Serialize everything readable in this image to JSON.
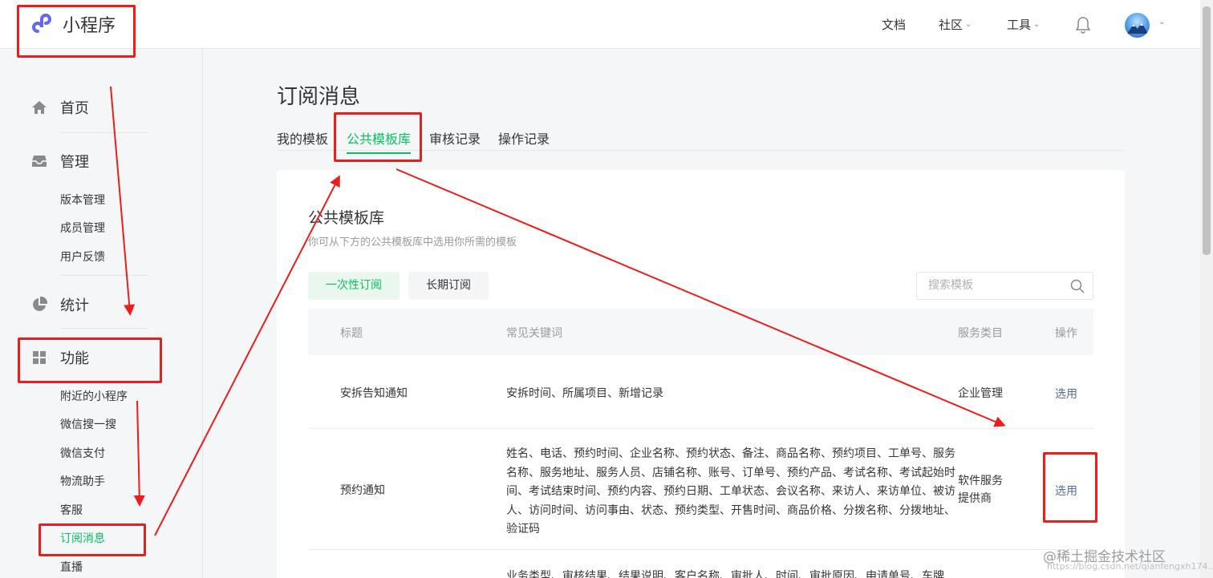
{
  "header": {
    "logo_text": "小程序",
    "nav": {
      "docs": "文档",
      "community": "社区",
      "tools": "工具"
    }
  },
  "sidebar": {
    "home": "首页",
    "manage": "管理",
    "manage_items": [
      "版本管理",
      "成员管理",
      "用户反馈"
    ],
    "stats": "统计",
    "features": "功能",
    "feature_items": [
      "附近的小程序",
      "微信搜一搜",
      "微信支付",
      "物流助手",
      "客服",
      "订阅消息",
      "直播"
    ]
  },
  "page": {
    "title": "订阅消息",
    "tabs": [
      "我的模板",
      "公共模板库",
      "审核记录",
      "操作记录"
    ],
    "active_tab": "公共模板库"
  },
  "library": {
    "title": "公共模板库",
    "subtitle": "你可从下方的公共模板库中选用你所需的模板",
    "segments": [
      "一次性订阅",
      "长期订阅"
    ],
    "search_placeholder": "搜索模板",
    "columns": [
      "标题",
      "常见关键词",
      "服务类目",
      "操作"
    ],
    "rows": [
      {
        "title": "安拆告知通知",
        "keywords": [
          "安拆时间、所属项目、新增记录"
        ],
        "category": [
          "企业管理"
        ],
        "action": "选用"
      },
      {
        "title": "预约通知",
        "keywords": [
          "姓名、电话、预约时间、企业名称、预约状态、备注、商品名称、预约项目、工单号、服务",
          "名称、服务地址、服务人员、店铺名称、账号、订单号、预约产品、考试名称、考试起始时",
          "间、考试结束时间、预约内容、预约日期、工单状态、会议名称、来访人、来访单位、被访",
          "人、访问时间、访问事由、状态、预约类型、开售时间、商品价格、分拨名称、分拨地址、",
          "验证码"
        ],
        "category": [
          "软件服务",
          "提供商"
        ],
        "action": "选用"
      },
      {
        "keywords": [
          "业务类型、审核结果、结果说明、客户名称、审批人、时间、审批原因、申请单号、车牌"
        ]
      }
    ]
  },
  "watermark": {
    "text": "@稀土掘金技术社区",
    "url": "https://blog.csdn.net/qianfengxh174..."
  },
  "colors": {
    "accent": "#07c160",
    "link": "#576b95",
    "annotation": "#ee1c1c"
  }
}
